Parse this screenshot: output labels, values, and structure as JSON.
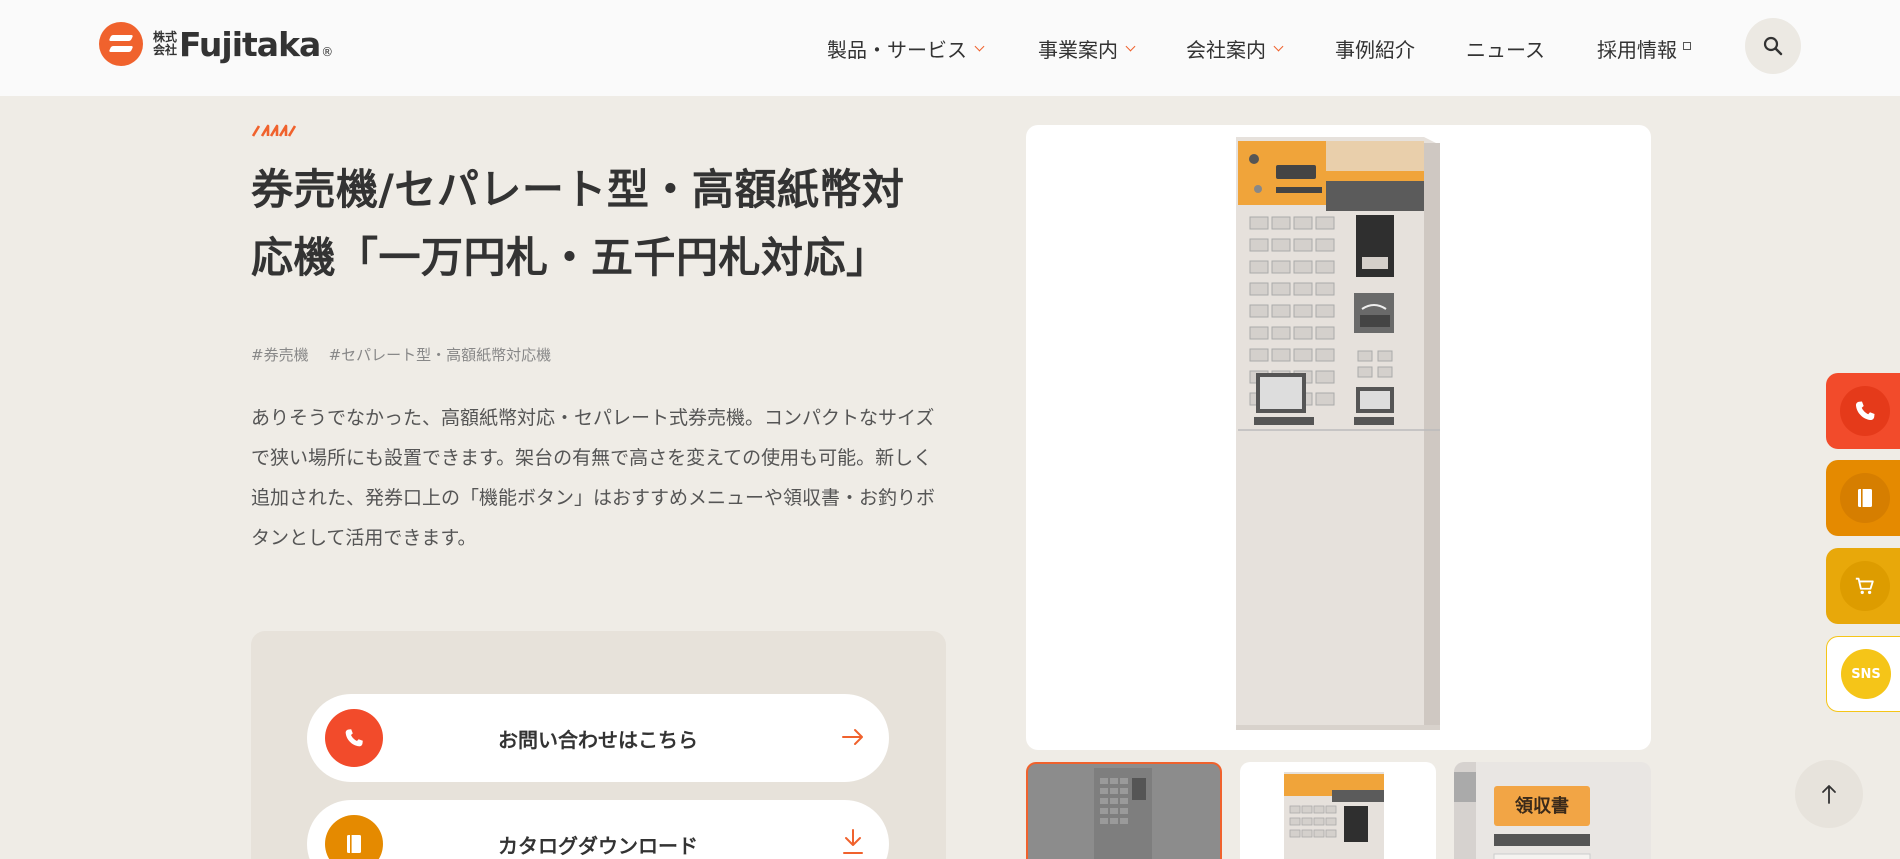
{
  "header": {
    "logo": {
      "prefix_line1": "株式",
      "prefix_line2": "会社",
      "name": "Fujitaka",
      "reg": "®"
    },
    "nav": [
      {
        "label": "製品・サービス"
      },
      {
        "label": "事業案内"
      },
      {
        "label": "会社案内"
      },
      {
        "label": "事例紹介"
      },
      {
        "label": "ニュース"
      },
      {
        "label": "採用情報"
      }
    ]
  },
  "product": {
    "title_line1": "券売機/セパレート型・高額紙幣対",
    "title_line2": "応機「一万円札・五千円札対応」",
    "tags": [
      "#券売機",
      "#セパレート型・高額紙幣対応機"
    ],
    "description": "ありそうでなかった、高額紙幣対応・セパレート式券売機。コンパクトなサイズで狭い場所にも設置できます。架台の有無で高さを変えての使用も可能。新しく追加された、発券口上の「機能ボタン」はおすすめメニューや領収書・お釣りボタンとして活用できます。",
    "thumb3_sign": "領収書"
  },
  "cta": {
    "contact_label": "お問い合わせはこちら",
    "catalog_label": "カタログダウンロード"
  },
  "side": {
    "sns_label": "SNS"
  },
  "colors": {
    "brand_orange": "#f0622d",
    "phone_red": "#f24b2b",
    "catalog_orange": "#e58a00",
    "cart_amber": "#e8a80a",
    "sns_yellow": "#f5c518",
    "background": "#efece6"
  }
}
